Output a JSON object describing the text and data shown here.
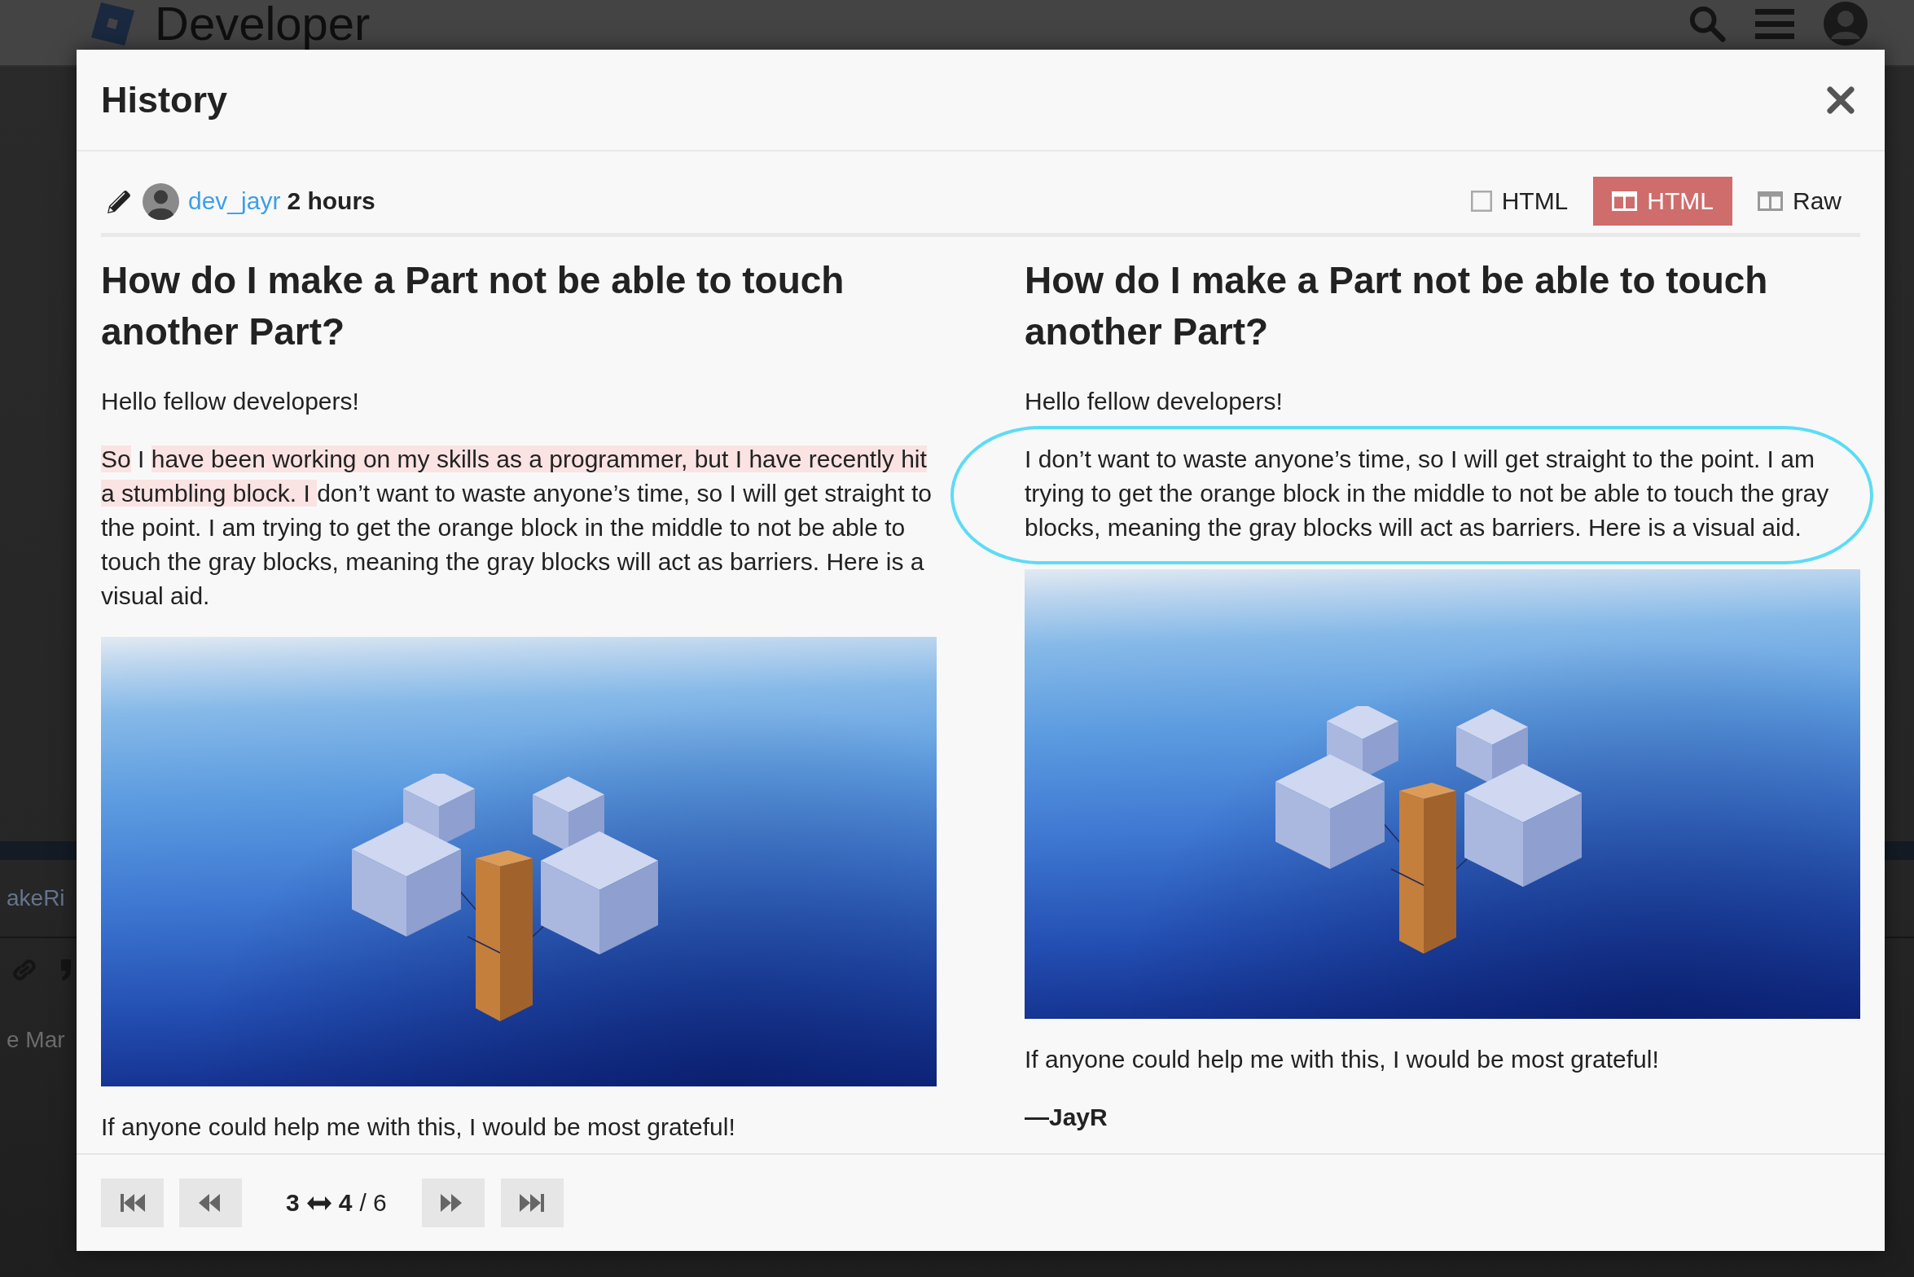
{
  "background_page": {
    "header_title": "Developer",
    "fragments": [
      "akeRi",
      "e Mar"
    ]
  },
  "dialog": {
    "title": "History"
  },
  "revision_bar": {
    "author": "dev_jayr",
    "age": "2 hours",
    "views": [
      {
        "label": "HTML",
        "kind": "inline",
        "selected": false
      },
      {
        "label": "HTML",
        "kind": "side_by_side",
        "selected": true
      },
      {
        "label": "Raw",
        "kind": "side_by_side_markdown",
        "selected": false
      }
    ]
  },
  "columns": [
    {
      "heading": "How do I make a Part not be able to touch another Part?",
      "blocks": [
        {
          "kind": "paragraph",
          "circled": false,
          "text": "Hello fellow developers!"
        },
        {
          "kind": "paragraph",
          "circled": false,
          "segments": [
            {
              "text": "So",
              "deleted": true
            },
            {
              "text": " I ",
              "deleted": false
            },
            {
              "text": "have been working on my skills as a programmer, but I have recently hit a stumbling block. I ",
              "deleted": true
            },
            {
              "text": "don’t want to waste anyone’s time, so I will get straight to the point. I am trying to get the orange block in the middle to not be able to touch the gray blocks, meaning the gray blocks will act as barriers. Here is a visual aid.",
              "deleted": false
            }
          ]
        },
        {
          "kind": "image"
        },
        {
          "kind": "paragraph",
          "circled": false,
          "text": "If anyone could help me with this, I would be most grateful!"
        }
      ]
    },
    {
      "heading": "How do I make a Part not be able to touch another Part?",
      "blocks": [
        {
          "kind": "paragraph",
          "circled": false,
          "text": "Hello fellow developers!"
        },
        {
          "kind": "paragraph",
          "circled": true,
          "text": "I don’t want to waste anyone’s time, so I will get straight to the point. I am trying to get the orange block in the middle to not be able to touch the gray blocks, meaning the gray blocks will act as barriers. Here is a visual aid."
        },
        {
          "kind": "image"
        },
        {
          "kind": "paragraph",
          "circled": false,
          "text": "If anyone could help me with this, I would be most grateful!"
        },
        {
          "kind": "signature",
          "text": "—JayR"
        }
      ]
    }
  ],
  "pager": {
    "from": "3",
    "to": "4",
    "total": "/ 6"
  }
}
